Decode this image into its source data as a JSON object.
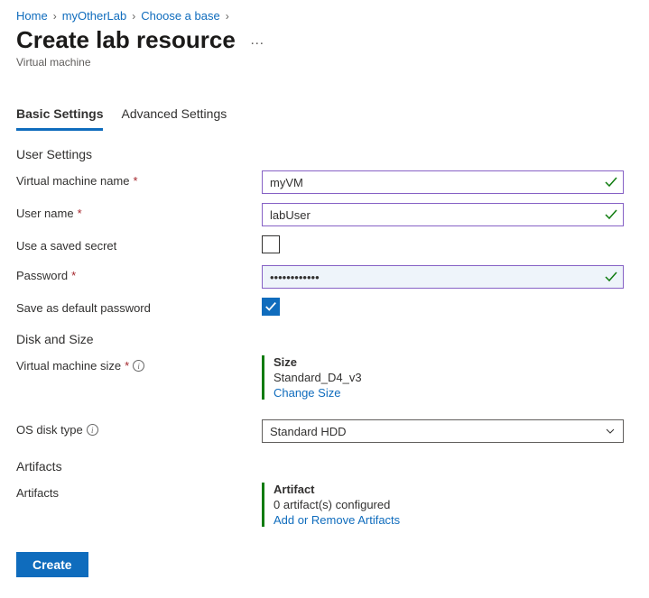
{
  "breadcrumb": {
    "items": [
      "Home",
      "myOtherLab",
      "Choose a base"
    ]
  },
  "header": {
    "title": "Create lab resource",
    "subtitle": "Virtual machine"
  },
  "tabs": {
    "basic": "Basic Settings",
    "advanced": "Advanced Settings"
  },
  "sections": {
    "user": "User Settings",
    "disk": "Disk and Size",
    "artifacts": "Artifacts"
  },
  "labels": {
    "vmName": "Virtual machine name",
    "userName": "User name",
    "useSavedSecret": "Use a saved secret",
    "password": "Password",
    "saveDefault": "Save as default password",
    "vmSize": "Virtual machine size",
    "osDiskType": "OS disk type",
    "artifacts": "Artifacts"
  },
  "values": {
    "vmName": "myVM",
    "userName": "labUser",
    "password": "••••••••••••",
    "osDiskType": "Standard HDD"
  },
  "sizeCard": {
    "heading": "Size",
    "value": "Standard_D4_v3",
    "link": "Change Size"
  },
  "artifactCard": {
    "heading": "Artifact",
    "value": "0 artifact(s) configured",
    "link": "Add or Remove Artifacts"
  },
  "buttons": {
    "create": "Create"
  }
}
